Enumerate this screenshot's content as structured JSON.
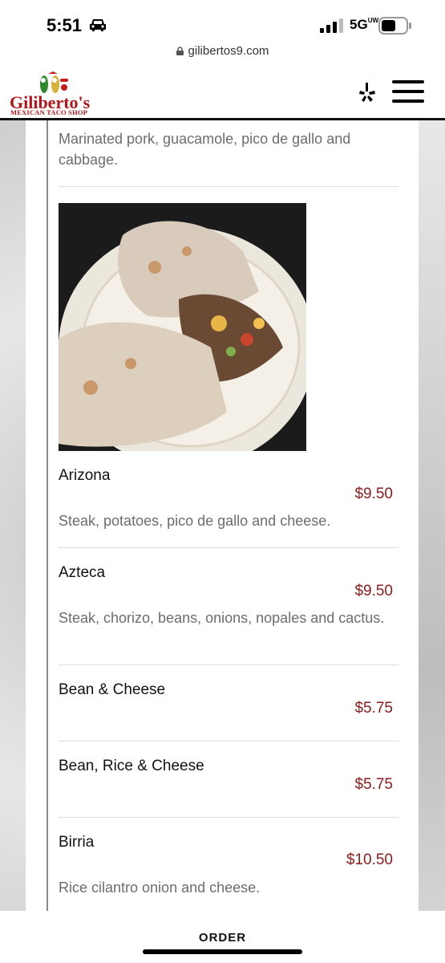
{
  "status": {
    "time": "5:51",
    "network": "5G",
    "network_sup": "UW"
  },
  "browser": {
    "url": "gilibertos9.com"
  },
  "header": {
    "logo_title": "Giliberto's",
    "logo_subtitle": "MEXICAN TACO SHOP"
  },
  "menu": {
    "prev_description": "Marinated pork, guacamole, pico de gallo and cabbage.",
    "items": [
      {
        "name": "Arizona",
        "price": "$9.50",
        "description": "Steak, potatoes, pico de gallo and cheese."
      },
      {
        "name": "Azteca",
        "price": "$9.50",
        "description": "Steak, chorizo, beans, onions, nopales and cactus."
      },
      {
        "name": "Bean & Cheese",
        "price": "$5.75",
        "description": ""
      },
      {
        "name": "Bean, Rice & Cheese",
        "price": "$5.75",
        "description": ""
      },
      {
        "name": "Birria",
        "price": "$10.50",
        "description": "Rice cilantro onion and cheese."
      }
    ]
  },
  "bottom_bar": {
    "order_label": "ORDER"
  },
  "colors": {
    "brand": "#b3151b",
    "price": "#8e1b1b"
  }
}
